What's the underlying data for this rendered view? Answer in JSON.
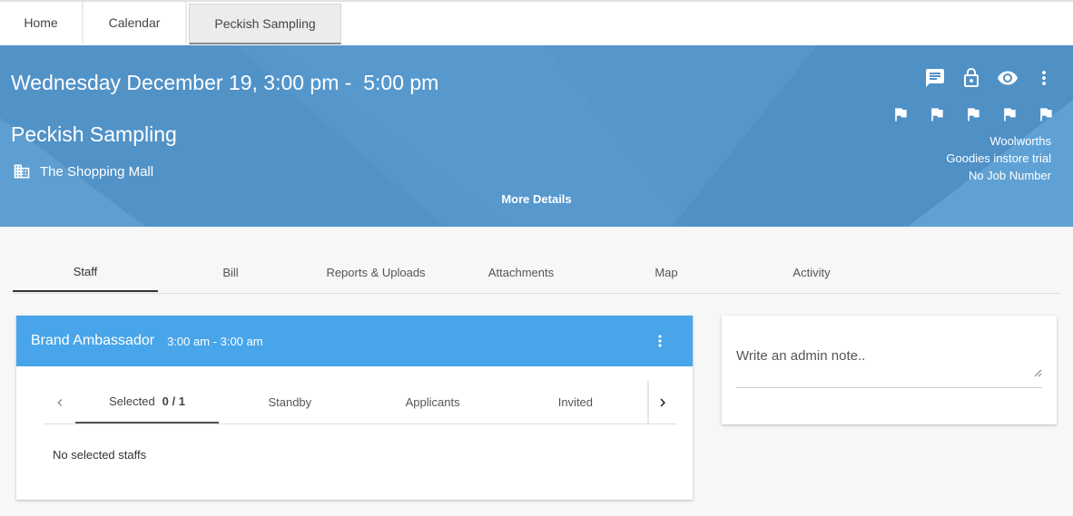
{
  "top_tabs": [
    "Home",
    "Calendar",
    "Peckish Sampling"
  ],
  "hero": {
    "date_time": "Wednesday December 19, 3:00 pm -  5:00 pm",
    "title": "Peckish Sampling",
    "location": "The Shopping Mall",
    "more_details": "More Details",
    "client": "Woolworths",
    "campaign": "Goodies instore trial",
    "job_number": "No Job Number",
    "icons": [
      "chat-icon",
      "lock-icon",
      "eye-icon",
      "more-vert-icon"
    ],
    "flags": [
      "flag-icon",
      "flag-icon",
      "flag-icon",
      "flag-icon",
      "flag-icon"
    ],
    "color": "#5596cb"
  },
  "content_tabs": [
    "Staff",
    "Bill",
    "Reports & Uploads",
    "Attachments",
    "Map",
    "Activity"
  ],
  "brand_card": {
    "role": "Brand Ambassador",
    "time": "3:00 am - 3:00 am",
    "header_color": "#48a5ea",
    "sub_tabs": {
      "selected_label": "Selected",
      "selected_count": "0 / 1",
      "standby": "Standby",
      "applicants": "Applicants",
      "invited": "Invited"
    },
    "empty_message": "No selected staffs"
  },
  "admin_note": {
    "placeholder": "Write an admin note.."
  }
}
